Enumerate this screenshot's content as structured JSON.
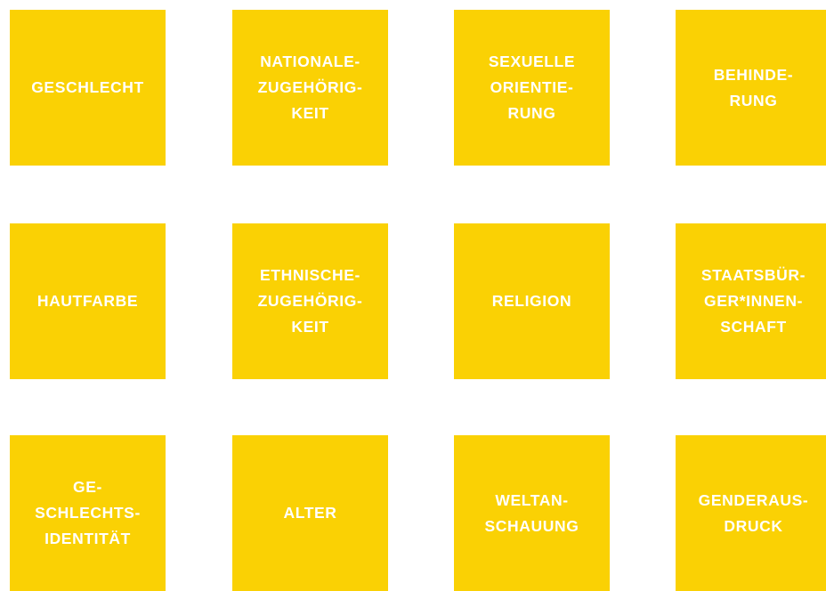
{
  "tiles": [
    {
      "label": "GESCHLECHT"
    },
    {
      "label": "NATIONALE-\nZUGEHÖRIG-\nKEIT"
    },
    {
      "label": "SEXUELLE\nORIENTIE-\nRUNG"
    },
    {
      "label": "BEHINDE-\nRUNG"
    },
    {
      "label": "HAUTFARBE"
    },
    {
      "label": "ETHNISCHE-\nZUGEHÖRIG-\nKEIT"
    },
    {
      "label": "RELIGION"
    },
    {
      "label": "STAATSBÜR-\nGER*INNEN-\nSCHAFT"
    },
    {
      "label": "GE-\nSCHLECHTS-\nIDENTITÄT"
    },
    {
      "label": "ALTER"
    },
    {
      "label": "WELTAN-\nSCHAUUNG"
    },
    {
      "label": "GENDERAUS-\nDRUCK"
    }
  ],
  "colors": {
    "tile_background": "#fad104",
    "tile_text": "#ffffff",
    "page_background": "#ffffff"
  }
}
